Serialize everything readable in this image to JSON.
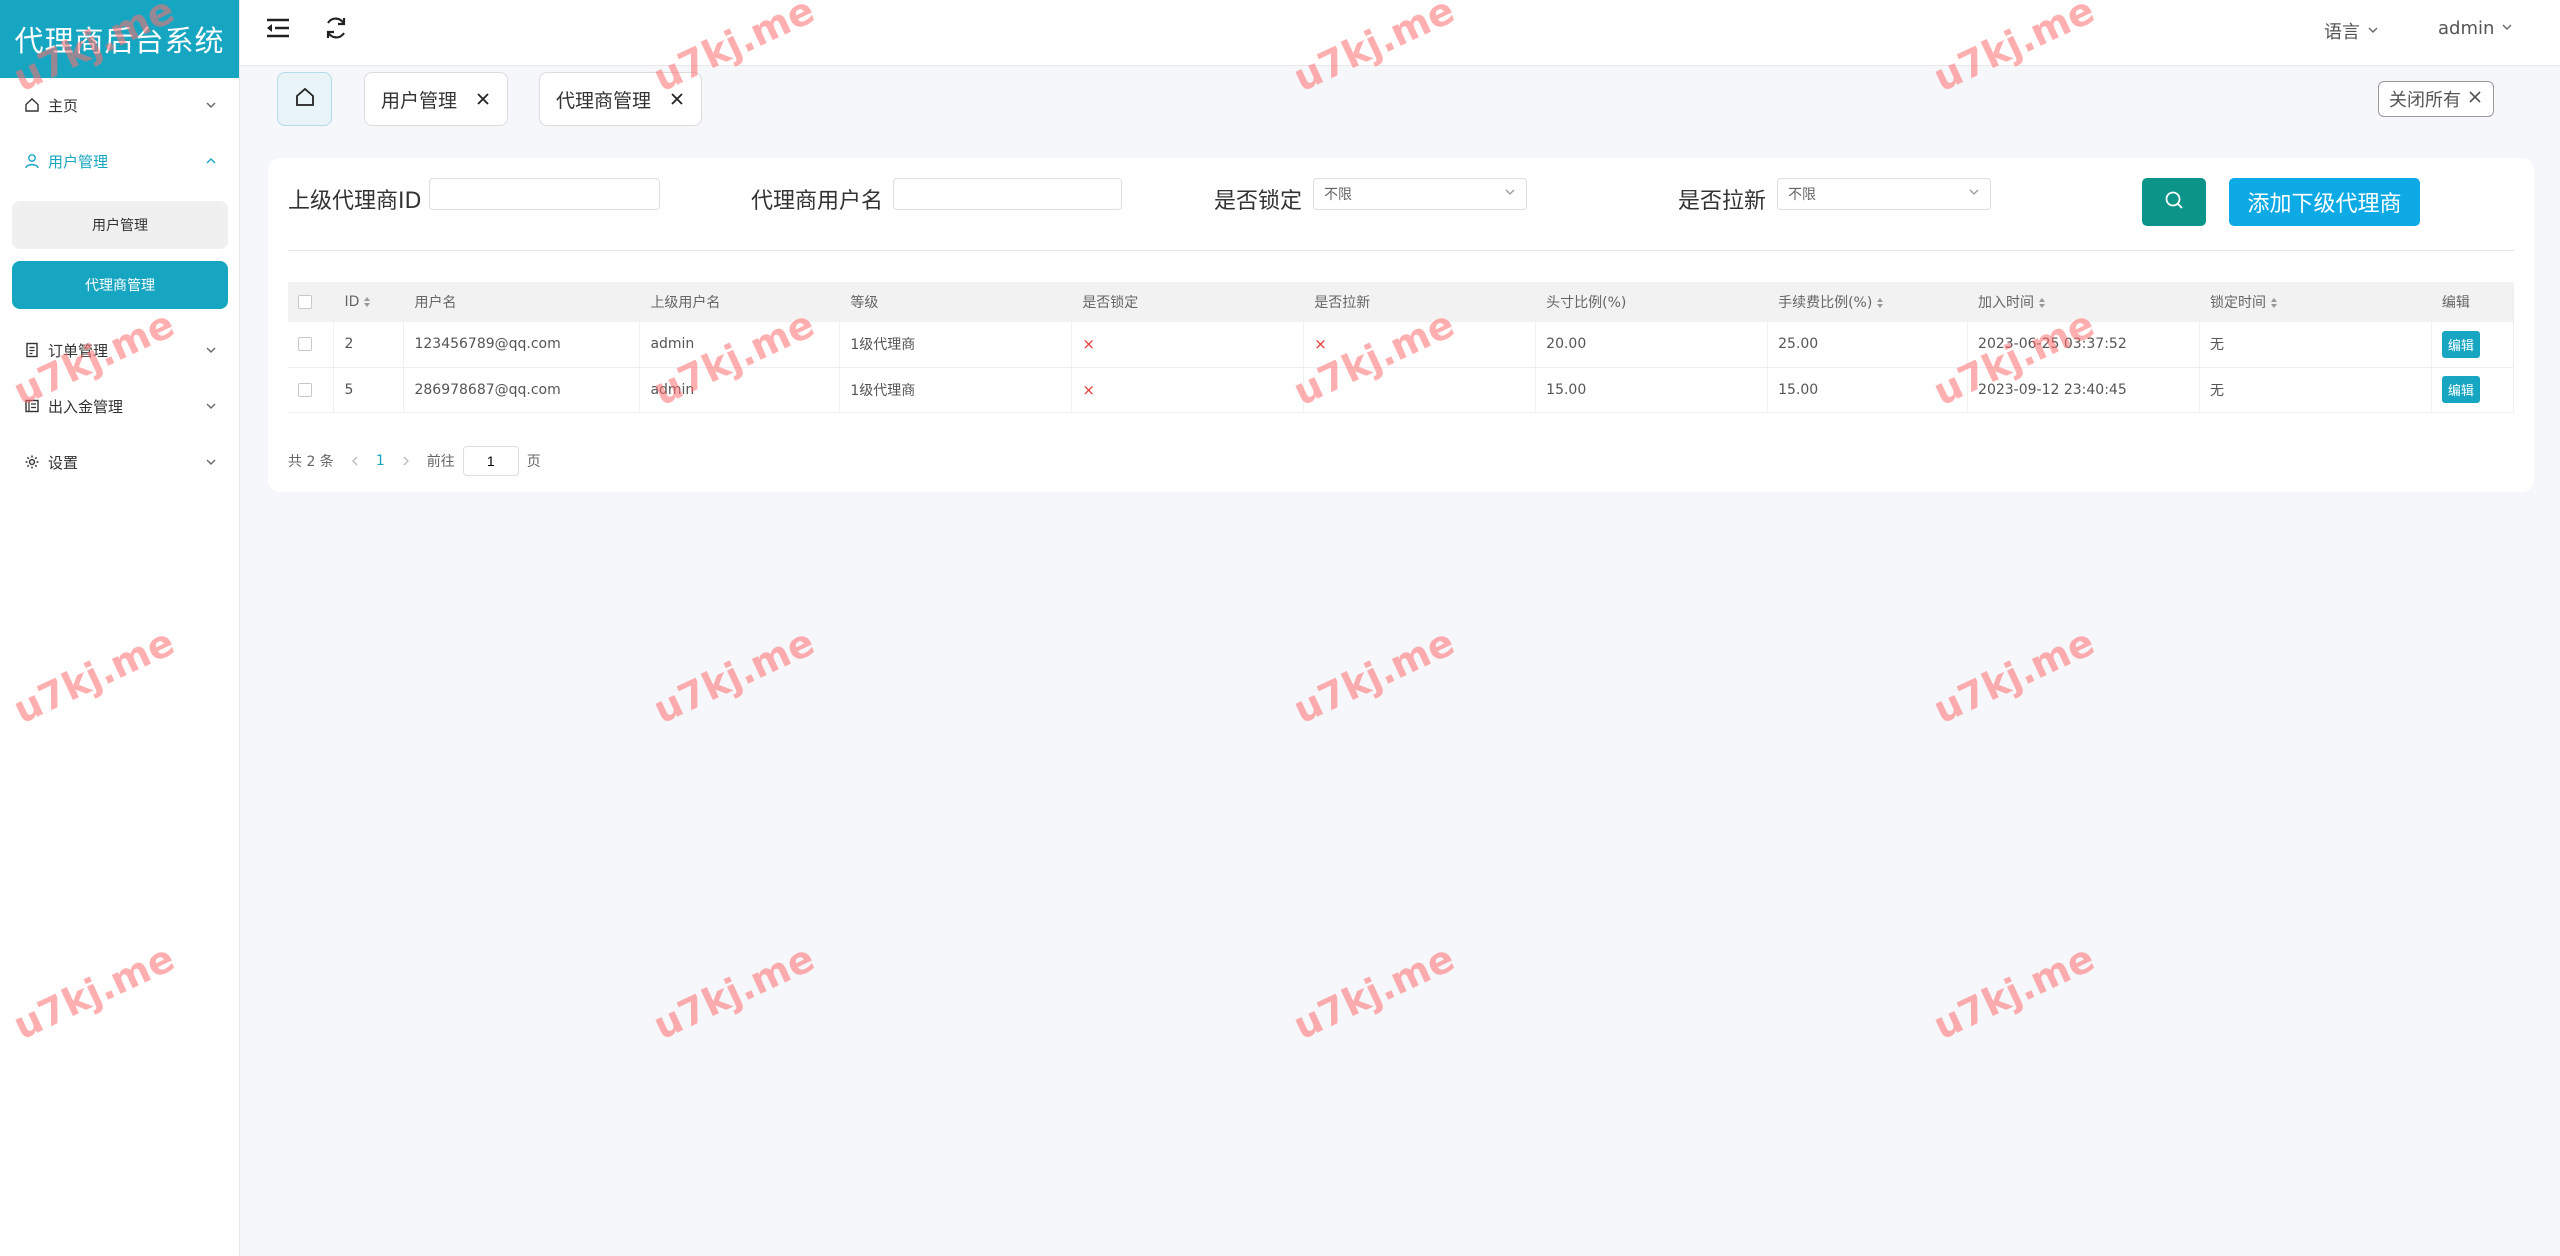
{
  "app": {
    "title": "代理商后台系统"
  },
  "sidebar": {
    "items": [
      {
        "label": "主页"
      },
      {
        "label": "用户管理"
      },
      {
        "label": "订单管理"
      },
      {
        "label": "出入金管理"
      },
      {
        "label": "设置"
      }
    ],
    "sub_items": [
      {
        "label": "用户管理"
      },
      {
        "label": "代理商管理"
      }
    ]
  },
  "header": {
    "language": "语言",
    "user": "admin"
  },
  "tabs": [
    {
      "label": "用户管理"
    },
    {
      "label": "代理商管理"
    }
  ],
  "close_all": "关闭所有",
  "filters": {
    "parent_id_label": "上级代理商ID",
    "parent_id_value": "",
    "username_label": "代理商用户名",
    "username_value": "",
    "locked_label": "是否锁定",
    "locked_value": "不限",
    "pull_new_label": "是否拉新",
    "pull_new_value": "不限",
    "add_button": "添加下级代理商"
  },
  "table": {
    "columns": [
      "ID",
      "用户名",
      "上级用户名",
      "等级",
      "是否锁定",
      "是否拉新",
      "头寸比例(%)",
      "手续费比例(%)",
      "加入时间",
      "锁定时间",
      "编辑"
    ],
    "rows": [
      {
        "id": "2",
        "username": "123456789@qq.com",
        "parent": "admin",
        "level": "1级代理商",
        "locked": "×",
        "pull_new": "×",
        "position_ratio": "20.00",
        "fee_ratio": "25.00",
        "join_time": "2023-06-25 03:37:52",
        "lock_time": "无",
        "edit": "编辑"
      },
      {
        "id": "5",
        "username": "286978687@qq.com",
        "parent": "admin",
        "level": "1级代理商",
        "locked": "×",
        "pull_new": "",
        "position_ratio": "15.00",
        "fee_ratio": "15.00",
        "join_time": "2023-09-12 23:40:45",
        "lock_time": "无",
        "edit": "编辑"
      }
    ]
  },
  "pagination": {
    "total": "共 2 条",
    "current": "1",
    "goto_prefix": "前往",
    "goto_value": "1",
    "goto_suffix": "页"
  },
  "watermark": "u7kj.me",
  "colors": {
    "accent": "#17a6c2",
    "search_button": "#0d9488",
    "add_button": "#0eaae6",
    "danger": "#e53935"
  }
}
